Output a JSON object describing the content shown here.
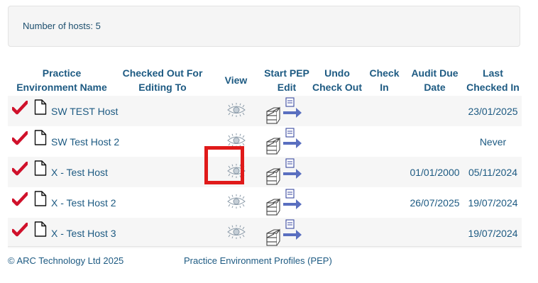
{
  "summary": {
    "label": "Number of hosts: 5"
  },
  "table": {
    "headers": {
      "name": [
        "Practice",
        "Environment Name"
      ],
      "checked_out_for": [
        "Checked Out For",
        "Editing To"
      ],
      "view": [
        "View"
      ],
      "start_pep_edit": [
        "Start PEP",
        "Edit"
      ],
      "undo_check_out": [
        "Undo",
        "Check Out"
      ],
      "check_in": [
        "Check",
        "In"
      ],
      "audit_due_date": [
        "Audit Due",
        "Date"
      ],
      "last_checked_in": [
        "Last",
        "Checked In"
      ]
    },
    "rows": [
      {
        "name": "SW TEST Host",
        "audit_due": "",
        "last_checked_in": "23/01/2025"
      },
      {
        "name": "SW Test Host 2",
        "audit_due": "",
        "last_checked_in": "Never"
      },
      {
        "name": "X - Test Host",
        "audit_due": "01/01/2000",
        "last_checked_in": "05/11/2024"
      },
      {
        "name": "X - Test Host 2",
        "audit_due": "26/07/2025",
        "last_checked_in": "19/07/2024"
      },
      {
        "name": "X - Test Host 3",
        "audit_due": "",
        "last_checked_in": "19/07/2024"
      }
    ]
  },
  "footer": {
    "copyright": "© ARC Technology Ltd 2025",
    "link": "Practice Environment Profiles (PEP)"
  },
  "icons": {
    "row_status": "red-check-icon",
    "row_type": "document-icon",
    "view": "eye-icon",
    "start_edit": "pep-edit-icon"
  },
  "colors": {
    "text": "#1d5a82",
    "check": "#d0112b",
    "highlight": "#e01a1a",
    "icon_accent": "#5a6fc0"
  }
}
